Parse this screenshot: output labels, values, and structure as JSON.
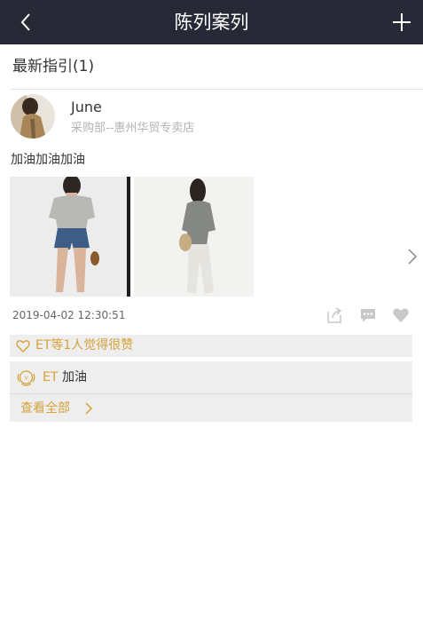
{
  "header": {
    "title": "陈列案列",
    "back_icon": "back-arrow-icon",
    "add_icon": "plus-icon",
    "background": "#272a36"
  },
  "section": {
    "heading": "最新指引(1)"
  },
  "post": {
    "user": {
      "name": "June",
      "department": "采购部--惠州华贸专卖店"
    },
    "text": "加油加油加油",
    "timestamp": "2019-04-02 12:30:51",
    "actions": {
      "share_icon": "share-icon",
      "comment_icon": "comment-icon",
      "like_icon": "heart-icon"
    },
    "likes_text": "ET等1人觉得很赞",
    "comments": [
      {
        "author": "ET",
        "text": "加油"
      }
    ],
    "view_all": "查看全部"
  },
  "colors": {
    "accent": "#d6a13a",
    "panel": "#eeeeee",
    "muted": "#b3b3b3"
  }
}
